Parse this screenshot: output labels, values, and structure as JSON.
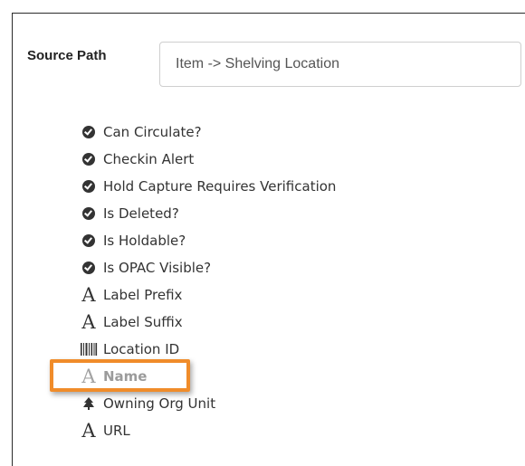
{
  "source_path": {
    "label": "Source Path",
    "value": "Item -> Shelving Location"
  },
  "fields": [
    {
      "icon": "check-circle-icon",
      "label": "Can Circulate?"
    },
    {
      "icon": "check-circle-icon",
      "label": "Checkin Alert"
    },
    {
      "icon": "check-circle-icon",
      "label": "Hold Capture Requires Verification"
    },
    {
      "icon": "check-circle-icon",
      "label": "Is Deleted?"
    },
    {
      "icon": "check-circle-icon",
      "label": "Is Holdable?"
    },
    {
      "icon": "check-circle-icon",
      "label": "Is OPAC Visible?"
    },
    {
      "icon": "font-icon",
      "label": "Label Prefix"
    },
    {
      "icon": "font-icon",
      "label": "Label Suffix"
    },
    {
      "icon": "barcode-icon",
      "label": "Location ID"
    },
    {
      "icon": "font-icon",
      "label": "Name"
    },
    {
      "icon": "org-tree-icon",
      "label": "Owning Org Unit"
    },
    {
      "icon": "font-icon",
      "label": "URL"
    }
  ],
  "highlighted_field": "Name",
  "colors": {
    "highlight_border": "#f08c2a",
    "text": "#333333"
  }
}
